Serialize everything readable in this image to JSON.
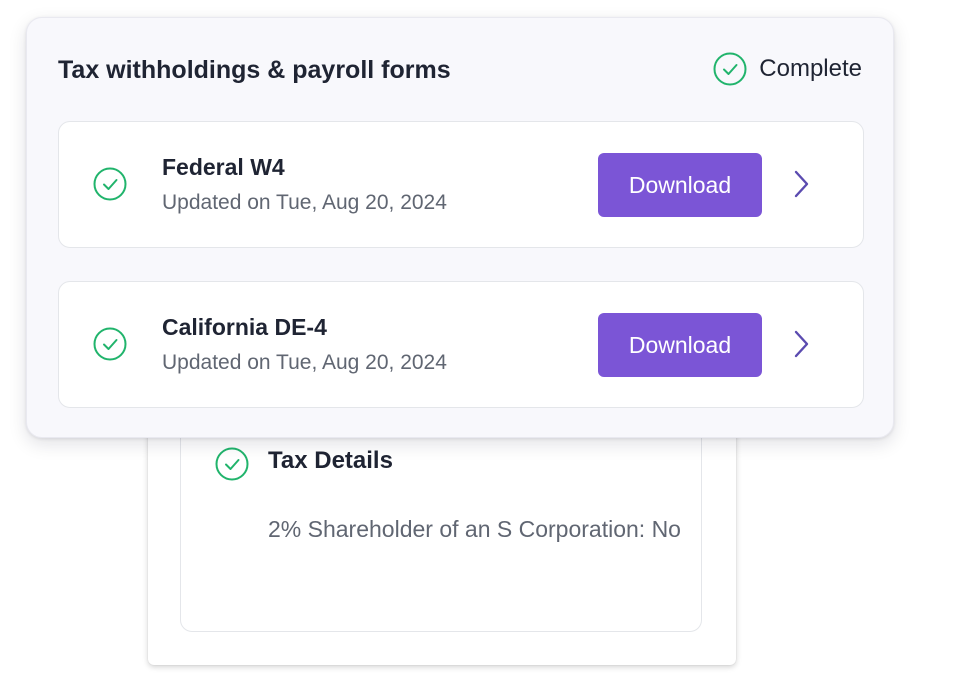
{
  "panel": {
    "title": "Tax withholdings & payroll forms",
    "status_label": "Complete",
    "status_icon": "check-circle-icon"
  },
  "forms": [
    {
      "name": "Federal W4",
      "updated": "Updated on Tue, Aug 20, 2024",
      "button_label": "Download"
    },
    {
      "name": "California DE-4",
      "updated": "Updated on Tue, Aug 20, 2024",
      "button_label": "Download"
    }
  ],
  "tax_details": {
    "title": "Tax Details",
    "text": "2% Shareholder of an S Corporation: No"
  },
  "colors": {
    "accent": "#7b55d6",
    "success": "#21b46c",
    "chevron": "#5b4bb0"
  }
}
